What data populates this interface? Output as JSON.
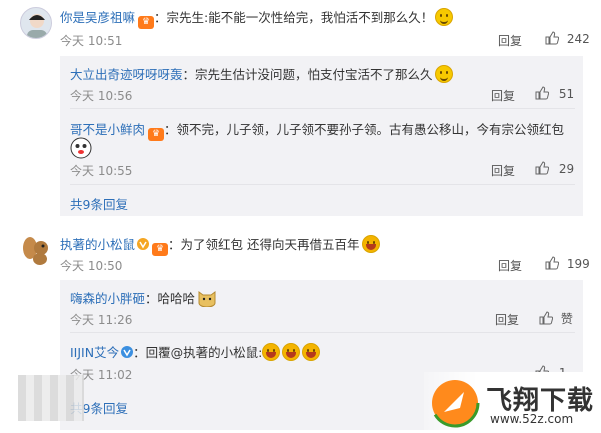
{
  "comments": [
    {
      "user": "你是吴彦祖嘛",
      "text": "：宗先生:能不能一次性给完，我怕活不到那么久！",
      "time": "今天 10:51",
      "reply_label": "回复",
      "likes": "242",
      "replies": [
        {
          "user": "大立出奇迹呀呀呀轰",
          "text": "：宗先生估计没问题，怕支付宝活不了那么久",
          "time": "今天 10:56",
          "reply_label": "回复",
          "likes": "51"
        },
        {
          "user": "哥不是小鲜肉",
          "text": "：领不完，儿子领，儿子领不要孙子领。古有愚公移山，今有宗公领红包",
          "time": "今天 10:55",
          "reply_label": "回复",
          "likes": "29"
        }
      ],
      "more_replies": "共9条回复"
    },
    {
      "user": "执著的小松鼠",
      "text": "：为了领红包 还得向天再借五百年",
      "time": "今天 10:50",
      "reply_label": "回复",
      "likes": "199",
      "replies": [
        {
          "user": "嗨森的小胖砸",
          "text": "：哈哈哈",
          "time": "今天 11:26",
          "reply_label": "回复",
          "likes": "赞"
        },
        {
          "user": "IIJIN艾今",
          "text": "：回覆@执著的小松鼠:",
          "time": "今天 11:02",
          "reply_label": "回复",
          "likes": "1"
        }
      ],
      "more_replies": "共9条回复"
    }
  ],
  "watermark": {
    "brand": "飞翔下载",
    "url": "www.52z.com"
  },
  "colors": {
    "link": "#2d6fb8",
    "subbg": "#f2f2f5",
    "brand": "#ff7a1a"
  }
}
